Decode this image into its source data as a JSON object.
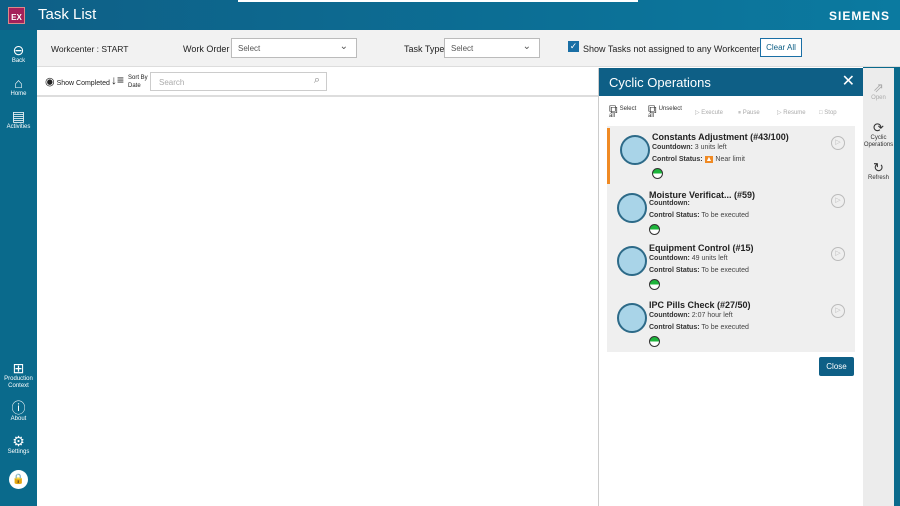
{
  "app": {
    "logo": "EX",
    "title": "Task List",
    "brand": "SIEMENS"
  },
  "sidebar": {
    "items": [
      {
        "label": "Back",
        "icon": "back-arrow-icon"
      },
      {
        "label": "Home",
        "icon": "home-icon"
      },
      {
        "label": "Activities",
        "icon": "clipboard-icon"
      },
      {
        "label": "Production Context",
        "icon": "grid-edit-icon"
      },
      {
        "label": "About",
        "icon": "info-icon"
      },
      {
        "label": "Settings",
        "icon": "gear-icon"
      }
    ]
  },
  "filters": {
    "workcenter": "Workcenter : START",
    "work_order_label": "Work Order",
    "work_order_value": "Select",
    "task_type_label": "Task Type",
    "task_type_value": "Select",
    "unassigned_label": "Show Tasks not assigned to any Workcenter",
    "unassigned_checked": true,
    "clear_all": "Clear All"
  },
  "toolbar": {
    "show_completed": "Show Completed",
    "sort_by": "Sort By",
    "sort_date": "Date",
    "search_placeholder": "Search"
  },
  "panel": {
    "title": "Cyclic Operations",
    "actions": {
      "select_all_1": "Select",
      "select_all_2": "all",
      "unselect_all_1": "Unselect",
      "unselect_all_2": "all",
      "execute": "Execute",
      "pause": "Pause",
      "resume": "Resume",
      "stop": "Stop"
    },
    "countdown_label": "Countdown:",
    "status_label": "Control Status:",
    "items": [
      {
        "title": "Constants Adjustment (#43/100)",
        "countdown": "3 units left",
        "status": "Near limit",
        "warning": true
      },
      {
        "title": "Moisture Verificat... (#59)",
        "countdown": "",
        "status": "To be executed"
      },
      {
        "title": "Equipment Control (#15)",
        "countdown": "49 units left",
        "status": "To be executed"
      },
      {
        "title": "IPC Pills Check (#27/50)",
        "countdown": "2:07 hour left",
        "status": "To be executed"
      }
    ],
    "close": "Close"
  },
  "rail": {
    "open": "Open",
    "cyclic_1": "Cyclic",
    "cyclic_2": "Operations",
    "refresh": "Refresh"
  },
  "colors": {
    "primary": "#0e5f86",
    "accent": "#f08a24",
    "status_green": "#1db53b"
  }
}
